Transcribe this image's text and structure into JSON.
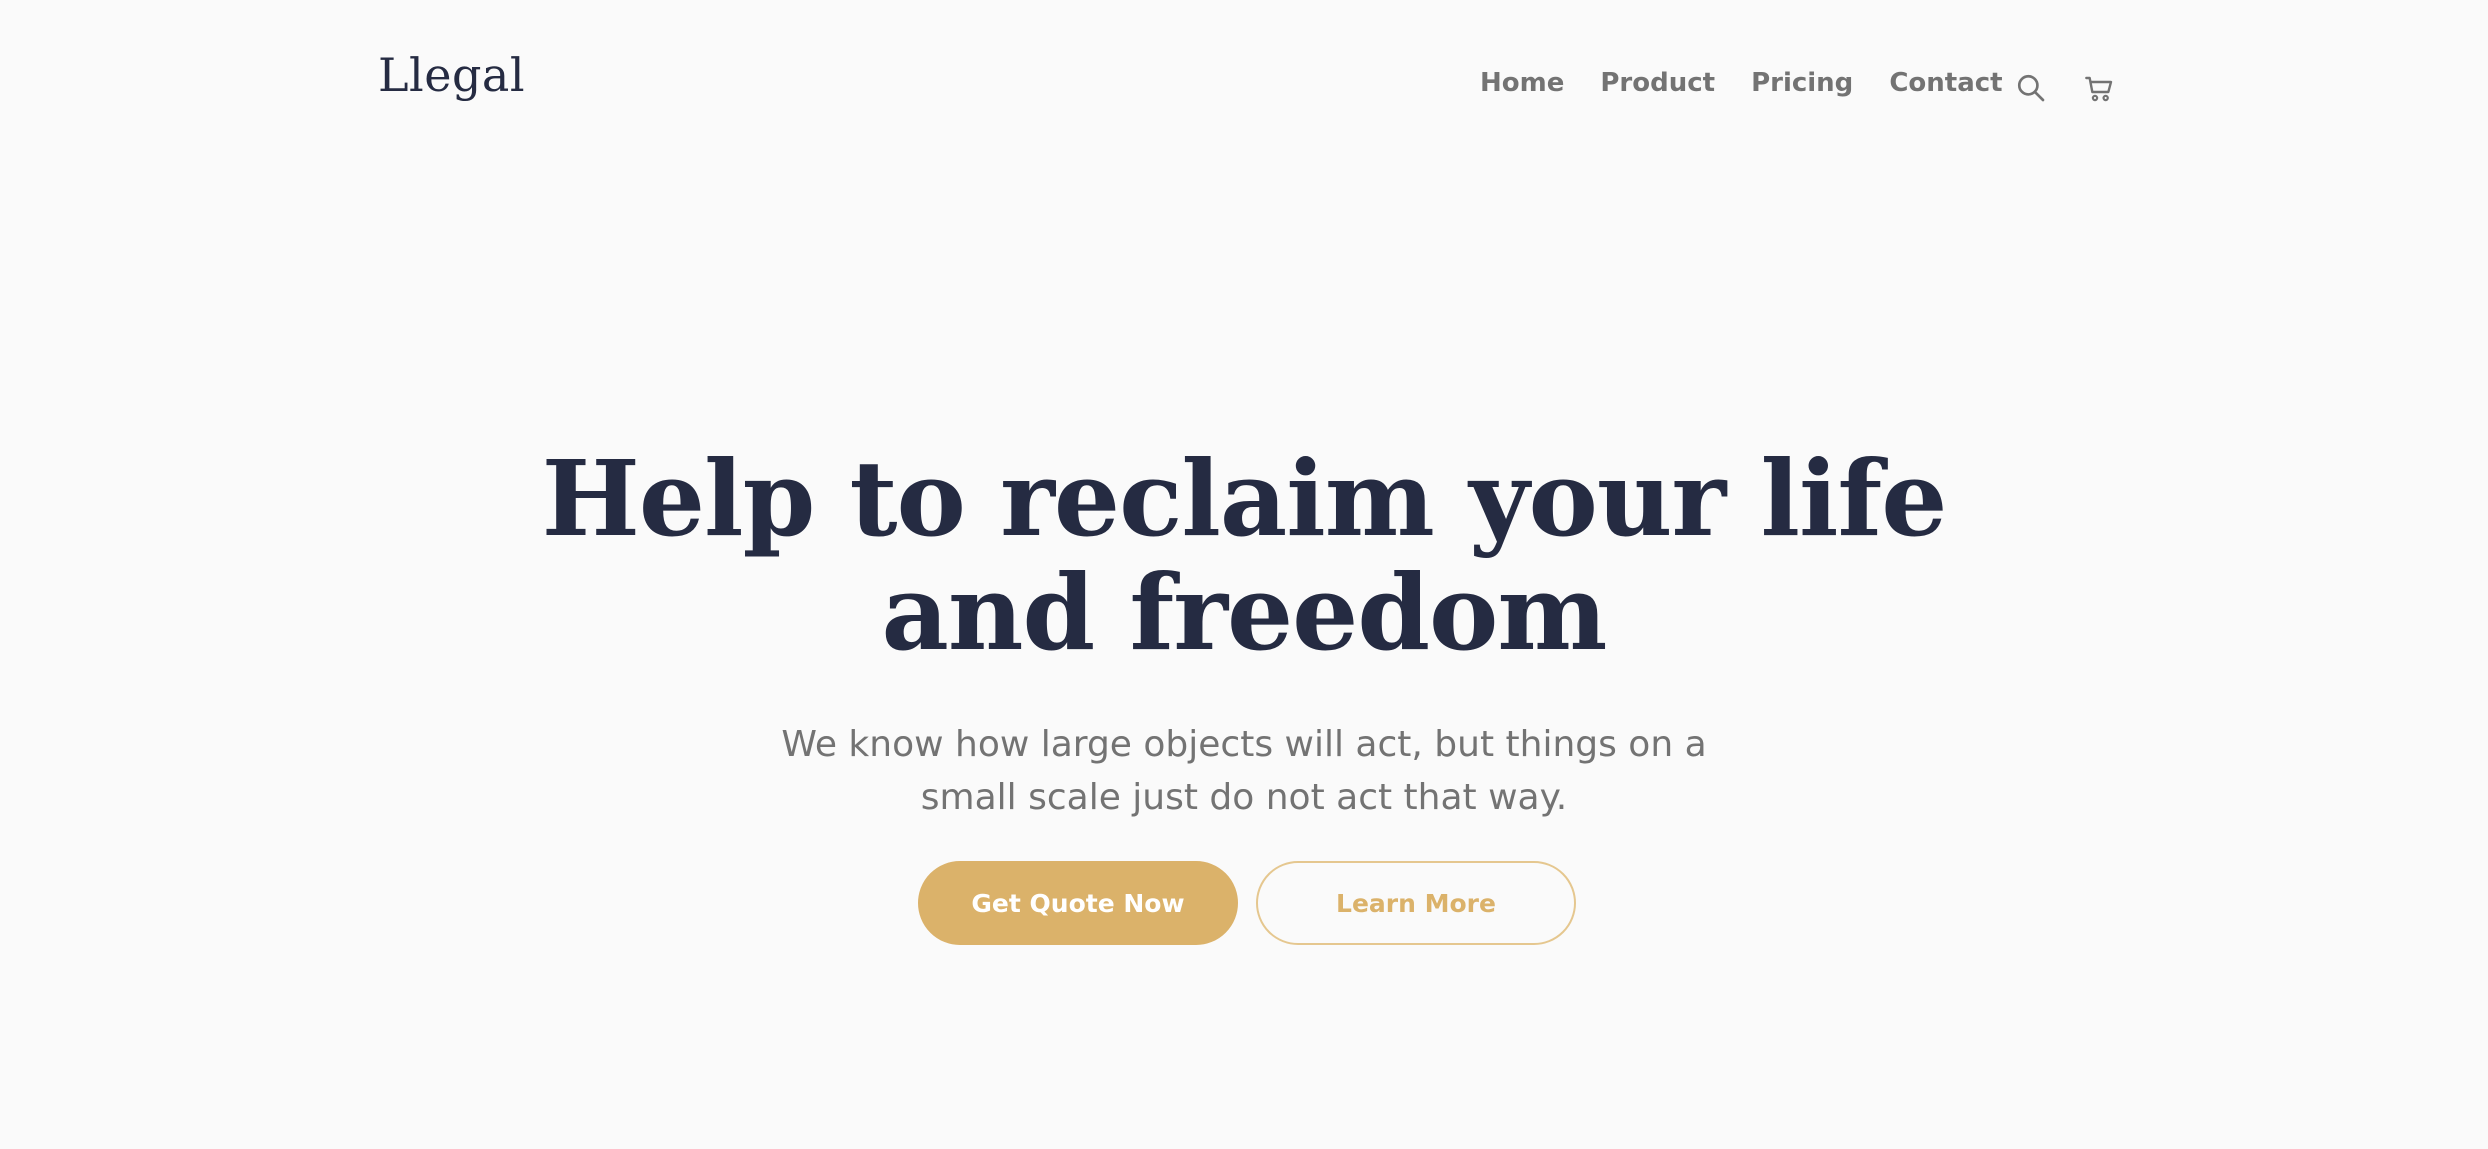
{
  "header": {
    "logo": "Llegal",
    "nav": {
      "items": [
        {
          "label": "Home"
        },
        {
          "label": "Product"
        },
        {
          "label": "Pricing"
        },
        {
          "label": "Contact"
        }
      ]
    },
    "icons": {
      "search": "search-icon",
      "cart": "cart-icon"
    }
  },
  "hero": {
    "title_line1": "Help to reclaim your life",
    "title_line2": "and freedom",
    "subtitle_line1": "We know how large objects will act, but things on a",
    "subtitle_line2": "small scale just do not act that way.",
    "primary_button": "Get Quote Now",
    "secondary_button": "Learn More"
  },
  "colors": {
    "background": "#fafafa",
    "heading": "#252b42",
    "text_muted": "#737373",
    "accent": "#dbb26a"
  }
}
